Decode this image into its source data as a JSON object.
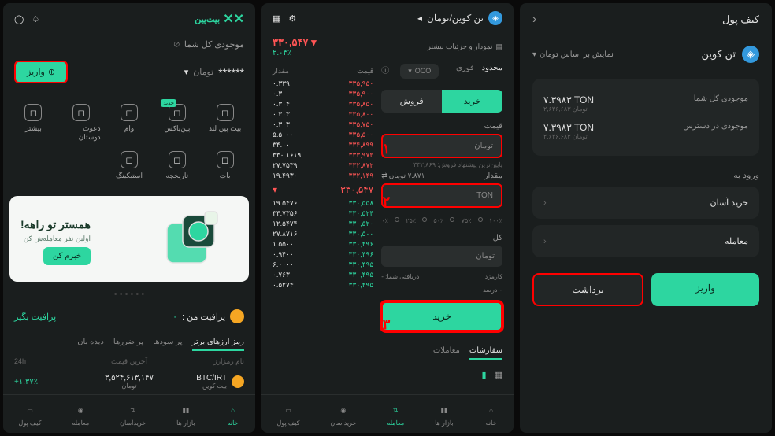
{
  "screen2": {
    "logo_text": "بیت‌پین",
    "balance_label": "موجودی کل شما",
    "balance_value": "******",
    "balance_unit": "تومان",
    "deposit_label": "واریز",
    "grid": [
      {
        "label": "بیت پین لند"
      },
      {
        "label": "پین‌باکس",
        "badge": "جدید"
      },
      {
        "label": "وام"
      },
      {
        "label": "دعوت دوستان"
      },
      {
        "label": ""
      },
      {
        "label": "بیشتر"
      },
      {
        "label": "بات"
      },
      {
        "label": "تاریخچه"
      },
      {
        "label": "استیکینگ"
      },
      {
        "label": ""
      }
    ],
    "banner": {
      "title": "همستر تو راهه!",
      "subtitle": "اولین نفر معامله‌ش کن",
      "button": "خبرم کن"
    },
    "profit_label": "پرافیت من :",
    "profit_value": "۰",
    "profit_link": "پرافیت بگیر",
    "tabs": [
      "رمز ارز‌های برتر",
      "پر سود‌ها",
      "پر ضرر‌ها",
      "دیده بان"
    ],
    "table_headers": [
      "نام رمزارز",
      "آخرین قیمت",
      "24h"
    ],
    "table_rows": [
      {
        "sym": "BTC/IRT",
        "name": "بیت کوین",
        "price": "۳,۵۲۴,۶۱۳,۱۴۷",
        "unit": "تومان",
        "change": "+۱.۳۷٪"
      }
    ],
    "bottom_nav": [
      "خانه",
      "بازار ها",
      "خریدآسان",
      "معامله",
      "کیف پول"
    ]
  },
  "screen1": {
    "pair": "تن کوین/تومان",
    "price": "۳۳۰,۵۴۷",
    "pct": "۲.۰۴٪",
    "chart_link": "نمودار و جزئیات بیشتر",
    "ob_headers": {
      "price": "قیمت",
      "amount": "مقدار"
    },
    "asks": [
      {
        "p": "۳۳۵,۹۵۰",
        "a": "۰.۳۳۹"
      },
      {
        "p": "۳۳۵,۹۰۰",
        "a": "۰.۳۰"
      },
      {
        "p": "۳۳۵,۸۵۰",
        "a": "۰.۳۰۴"
      },
      {
        "p": "۳۳۵,۸۰۰",
        "a": "۰.۳۰۳"
      },
      {
        "p": "۳۳۵,۷۵۰",
        "a": "۰.۳۰۳"
      },
      {
        "p": "۳۳۵,۵۰۰",
        "a": "۵.۵۰۰۰"
      },
      {
        "p": "۳۳۴,۸۹۹",
        "a": "۳۴.۰۰"
      },
      {
        "p": "۳۳۳,۹۷۲",
        "a": "۳۳۰.۱۶۱۹"
      },
      {
        "p": "۳۳۲,۸۷۲",
        "a": "۲۷.۷۵۳۹"
      },
      {
        "p": "۳۳۲,۱۴۹",
        "a": "۱۹.۴۹۳۰"
      }
    ],
    "mid_price": "۳۳۰,۵۴۷",
    "bids": [
      {
        "p": "۳۳۰,۵۵۸",
        "a": "۱۹.۵۴۷۶"
      },
      {
        "p": "۳۳۰,۵۲۴",
        "a": "۳۴.۷۳۵۶"
      },
      {
        "p": "۳۳۰,۵۲۰",
        "a": "۱۲.۵۴۷۴"
      },
      {
        "p": "۳۳۰,۵۰۰",
        "a": "۲۷.۸۷۱۶"
      },
      {
        "p": "۳۳۰,۴۹۶",
        "a": "۱.۵۵۰۰"
      },
      {
        "p": "۳۳۰,۴۹۶",
        "a": "۰.۹۴۰۰"
      },
      {
        "p": "۳۳۰,۴۹۵",
        "a": "۶.۰۰۰۰"
      },
      {
        "p": "۳۳۰,۴۹۵",
        "a": "۰.۷۶۳"
      },
      {
        "p": "۳۳۰,۴۹۵",
        "a": "۰.۵۲۷۴"
      }
    ],
    "type_tabs": {
      "limit": "محدود",
      "market": "فوری",
      "oco": "OCO"
    },
    "buy_label": "خرید",
    "sell_label": "فروش",
    "price_label": "قیمت",
    "price_placeholder": "تومان",
    "price_hint": "پایین‌ترین پیشنهاد فروش: ۳۳۲,۸۶۹",
    "amount_label": "مقدار",
    "amount_placeholder": "TON",
    "amount_conv": "۷.۸۷۱ تومان",
    "slider": [
      "۱۰۰٪",
      "۷۵٪",
      "۵۰٪",
      "۲۵٪",
      "۰٪"
    ],
    "total_label": "کل",
    "total_placeholder": "تومان",
    "fee_label": "کارمزد",
    "fee_value": "۰ درصد",
    "receive_label": "دریافتی شما:",
    "receive_value": "-",
    "submit_label": "خرید",
    "bottom_tabs": [
      "سفارشات",
      "معاملات"
    ],
    "bottom_nav": [
      "خانه",
      "بازار ها",
      "معامله",
      "خریدآسان",
      "کیف پول"
    ]
  },
  "screen3": {
    "title": "کیف پول",
    "coin_name": "تن کوین",
    "display_toggle": "نمایش بر اساس تومان",
    "balance": {
      "total_label": "موجودی کل شما",
      "total_value": "۷.۳۹۸۳ TON",
      "total_sub": "۲,۶۳۶,۶۸۳ تومان",
      "available_label": "موجودی در دسترس",
      "available_value": "۷.۳۹۸۳ TON",
      "available_sub": "۲,۶۳۶,۶۸۳ تومان"
    },
    "section_title": "ورود به",
    "nav_items": [
      "خرید آسان",
      "معامله"
    ],
    "deposit_label": "واریز",
    "withdraw_label": "برداشت"
  }
}
